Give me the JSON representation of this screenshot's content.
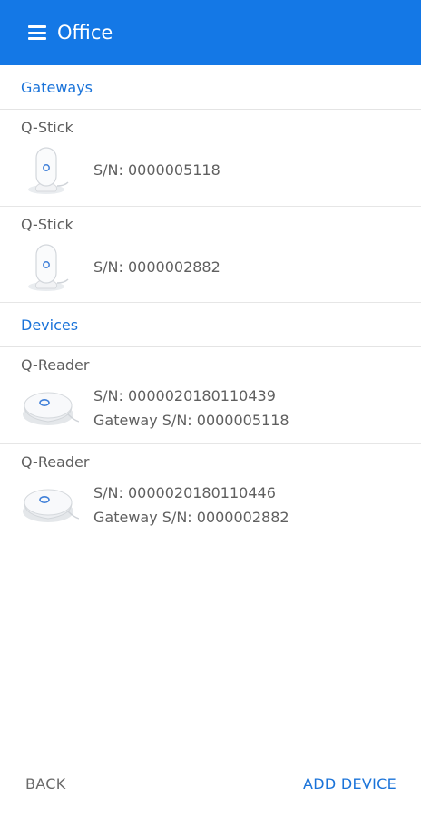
{
  "appbar": {
    "title": "Office",
    "menu_icon": "hamburger-menu-icon",
    "background_color": "#1478e6"
  },
  "sections": {
    "gateways_label": "Gateways",
    "devices_label": "Devices"
  },
  "gateways": [
    {
      "name": "Q-Stick",
      "serial": "S/N: 0000005118",
      "icon": "q-stick-device-image"
    },
    {
      "name": "Q-Stick",
      "serial": "S/N: 0000002882",
      "icon": "q-stick-device-image"
    }
  ],
  "devices": [
    {
      "name": "Q-Reader",
      "serial": "S/N: 0000020180110439",
      "gateway": "Gateway S/N: 0000005118",
      "icon": "q-reader-device-image"
    },
    {
      "name": "Q-Reader",
      "serial": "S/N: 0000020180110446",
      "gateway": "Gateway S/N: 0000002882",
      "icon": "q-reader-device-image"
    }
  ],
  "footer": {
    "back_label": "BACK",
    "add_device_label": "ADD DEVICE"
  },
  "colors": {
    "accent": "#1a73d9",
    "text": "#5f5f5f"
  }
}
